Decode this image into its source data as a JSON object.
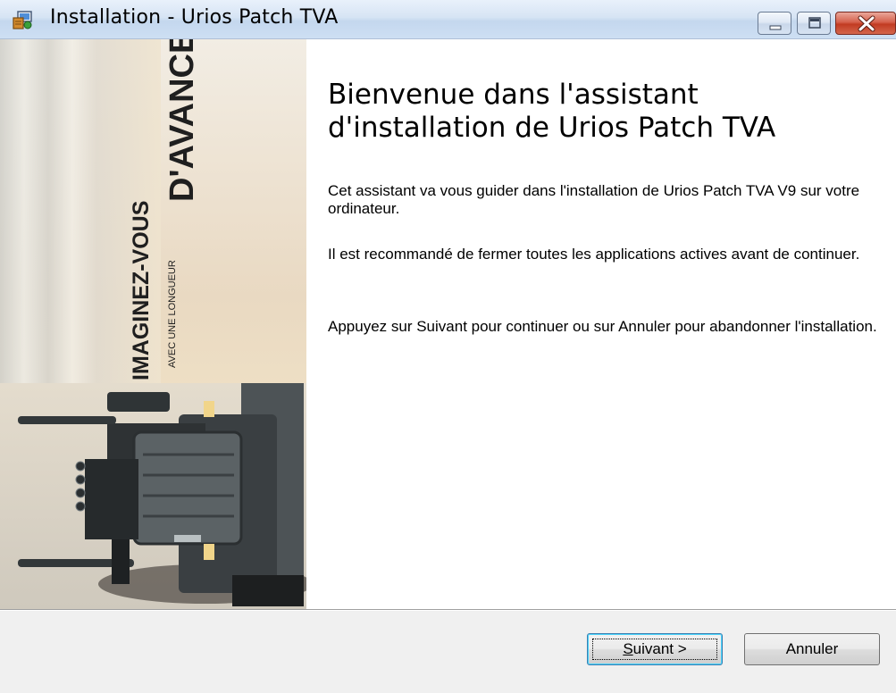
{
  "window": {
    "title": "Installation - Urios Patch TVA",
    "controls": [
      "minimize-icon",
      "maximize-icon",
      "close-icon"
    ]
  },
  "side_image": {
    "slogan_main": "IMAGINEZ-VOUS",
    "slogan_small": "AVEC UNE LONGUEUR",
    "slogan_big": "D'AVANCE"
  },
  "content": {
    "heading": "Bienvenue dans l'assistant d'installation de Urios Patch TVA",
    "paragraphs": [
      "Cet assistant va vous guider dans l'installation de Urios Patch TVA V9 sur votre ordinateur.",
      "Il est recommandé de fermer toutes les applications actives avant de continuer.",
      "Appuyez sur Suivant pour continuer ou sur Annuler pour abandonner l'installation."
    ]
  },
  "footer": {
    "next_accel": "S",
    "next_rest": "uivant >",
    "cancel_label": "Annuler"
  }
}
